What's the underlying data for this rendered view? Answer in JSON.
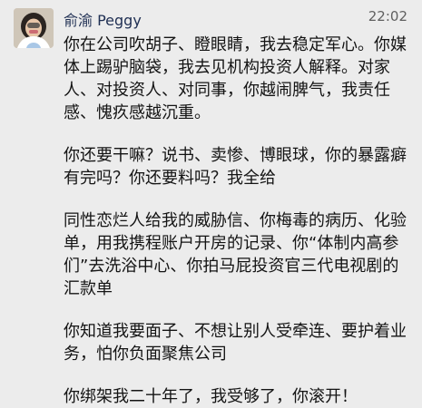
{
  "sender": {
    "name": "俞渝 Peggy",
    "time": "22:02"
  },
  "message": {
    "paragraphs": [
      "你在公司吹胡子、瞪眼睛，我去稳定军心。你媒体上踢驴脑袋，我去见机构投资人解释。对家人、对投资人、对同事，你越闹脾气，我责任感、愧疚感越沉重。",
      "你还要干嘛？说书、卖惨、博眼球，你的暴露癖有完吗？你还要料吗？我全给",
      "同性恋烂人给我的威胁信、你梅毒的病历、化验单，用我携程账户开房的记录、你“体制内高参们”去洗浴中心、你拍马屁投资官三代电视剧的汇款单",
      "你知道我要面子、不想让别人受牵连、要护着业务，怕你负面聚焦公司",
      "你绑架我二十年了，我受够了，你滚开！"
    ]
  }
}
